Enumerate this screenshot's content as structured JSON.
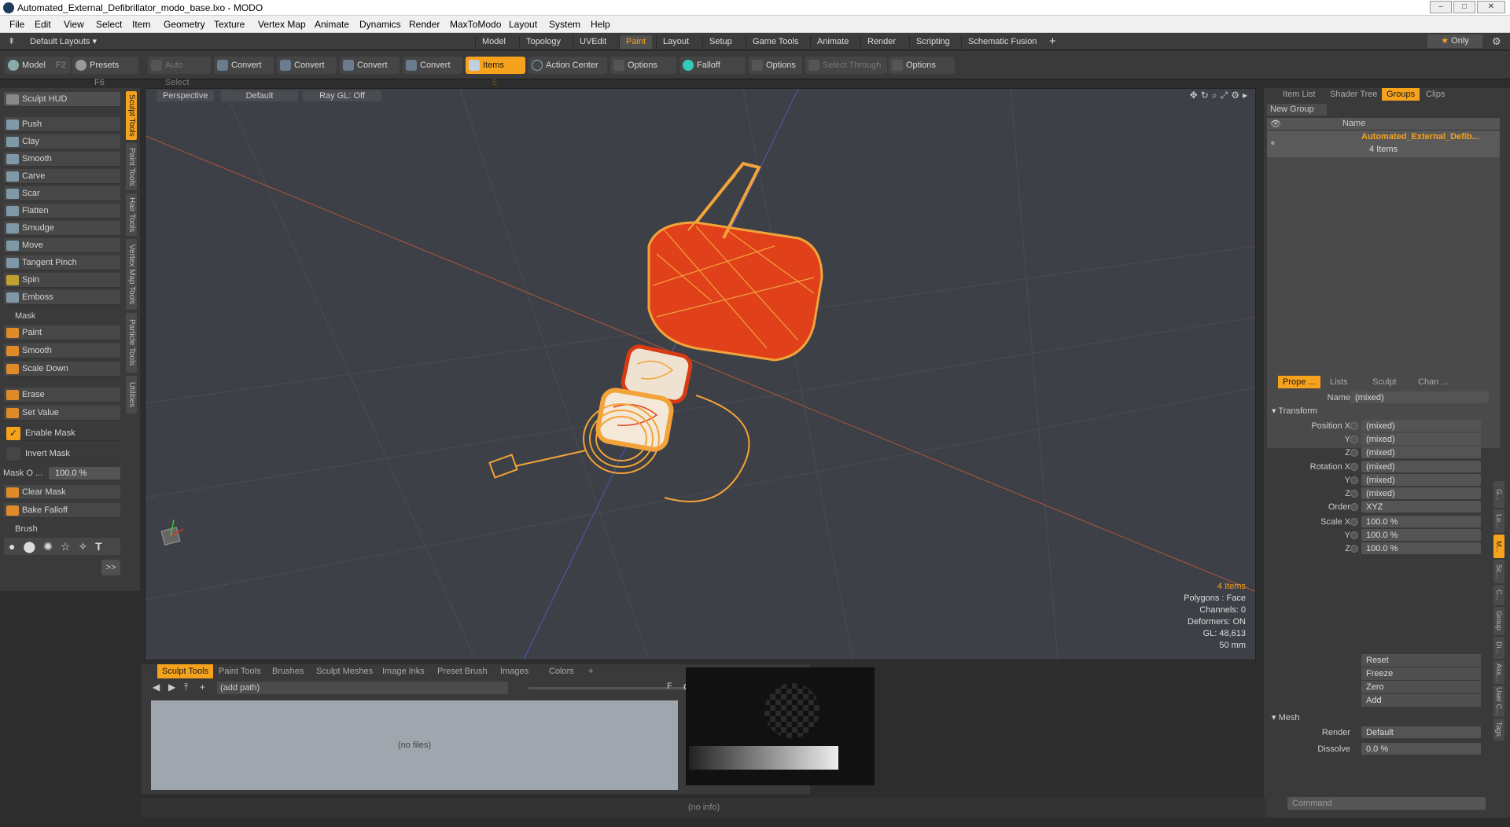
{
  "app": {
    "title": "Automated_External_Defibrillator_modo_base.lxo - MODO",
    "window_buttons": [
      "–",
      "□",
      "✕"
    ]
  },
  "menu": [
    "File",
    "Edit",
    "View",
    "Select",
    "Item",
    "Geometry",
    "Texture",
    "Vertex Map",
    "Animate",
    "Dynamics",
    "Render",
    "MaxToModo",
    "Layout",
    "System",
    "Help"
  ],
  "layouts": {
    "dropdown": "Default Layouts",
    "tabs": [
      "Model",
      "Topology",
      "UVEdit",
      "Paint",
      "Layout",
      "Setup",
      "Game Tools",
      "Animate",
      "Render",
      "Scripting",
      "Schematic Fusion"
    ],
    "active": "Paint",
    "add": "+",
    "only": "Only"
  },
  "toolbar": {
    "model": "Model",
    "model_key": "F2",
    "presets": "Presets",
    "presets_key": "F6",
    "auto_select": "Auto Select",
    "convert": "Convert",
    "items": "Items",
    "items_key": "5",
    "action_center": "Action Center",
    "options": "Options",
    "falloff": "Falloff",
    "select_through": "Select Through"
  },
  "left": {
    "hud": "Sculpt HUD",
    "tools": [
      "Push",
      "Clay",
      "Smooth",
      "Carve",
      "Scar",
      "Flatten",
      "Smudge",
      "Move",
      "Tangent Pinch",
      "Spin",
      "Emboss"
    ],
    "mask_head": "Mask",
    "mask_tools": [
      "Paint",
      "Smooth",
      "Scale Down"
    ],
    "erase": "Erase",
    "set_value": "Set Value",
    "enable_mask": "Enable Mask",
    "invert_mask": "Invert Mask",
    "mask_opacity_label": "Mask O ...",
    "mask_opacity": "100.0 %",
    "clear_mask": "Clear Mask",
    "bake_falloff": "Bake Falloff",
    "brush_head": "Brush",
    "more": ">>",
    "vtabs": [
      "Sculpt Tools",
      "Paint Tools",
      "Hair Tools",
      "Vertex Map Tools",
      "Particle Tools",
      "Utilities"
    ]
  },
  "viewport": {
    "view": "Perspective",
    "shading": "Default",
    "raygl": "Ray GL: Off",
    "info": [
      "4 Items",
      "Polygons : Face",
      "Channels: 0",
      "Deformers: ON",
      "GL: 48,613",
      "50 mm"
    ]
  },
  "bottom": {
    "tabs": [
      "Sculpt Tools",
      "Paint Tools",
      "Brushes",
      "Sculpt Meshes",
      "Image Inks",
      "Preset Brush",
      "Images",
      "Colors"
    ],
    "add": "+",
    "path": "(add path)",
    "no_files": "(no files)",
    "filter_key": "F"
  },
  "right": {
    "tabs": [
      "Item List",
      "Shader Tree",
      "Groups",
      "Clips"
    ],
    "active_tab": "Groups",
    "new_group": "New Group",
    "col_name": "Name",
    "group_name": "Automated_External_Defib...",
    "group_count": "4 Items",
    "prop_tabs": [
      "Prope ...",
      "Lists",
      "Sculpt",
      "Chan ..."
    ],
    "props": {
      "name_label": "Name",
      "name": "(mixed)",
      "transform": "Transform",
      "rows": [
        {
          "label": "Position X",
          "value": "(mixed)"
        },
        {
          "label": "Y",
          "value": "(mixed)"
        },
        {
          "label": "Z",
          "value": "(mixed)"
        },
        {
          "label": "Rotation X",
          "value": "(mixed)"
        },
        {
          "label": "Y",
          "value": "(mixed)"
        },
        {
          "label": "Z",
          "value": "(mixed)"
        },
        {
          "label": "Order",
          "value": "XYZ"
        },
        {
          "label": "Scale X",
          "value": "100.0 %"
        },
        {
          "label": "Y",
          "value": "100.0 %"
        },
        {
          "label": "Z",
          "value": "100.0 %"
        }
      ],
      "actions": [
        "Reset",
        "Freeze",
        "Zero",
        "Add"
      ],
      "mesh": "Mesh",
      "render_label": "Render",
      "render": "Default",
      "dissolve_label": "Dissolve",
      "dissolve": "0.0 %"
    },
    "side_tabs": [
      "G...",
      "Lo...",
      "M...",
      "Sc...",
      "C...",
      "Group",
      "Di...",
      "Ass...",
      "User C...",
      "Tags"
    ],
    "command": "Command"
  },
  "status": "(no info)",
  "colors": {
    "accent": "#f6a21c",
    "wire": "#f2a33a",
    "red": "#e0401a"
  }
}
